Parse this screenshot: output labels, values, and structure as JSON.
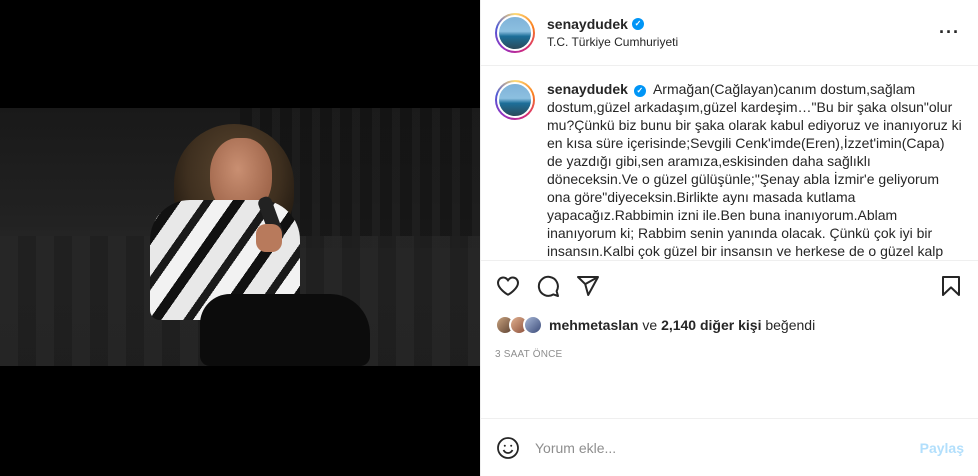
{
  "post": {
    "username": "senaydudek",
    "location": "T.C. Türkiye Cumhuriyeti",
    "more_icon": "more-horizontal-icon",
    "verified_icon": "verified-badge-icon"
  },
  "caption": {
    "username": "senaydudek",
    "text": "Armağan(Cağlayan)canım dostum,sağlam dostum,güzel arkadaşım,güzel kardeşim…\"Bu bir şaka olsun\"olur mu?Çünkü biz bunu bir şaka olarak kabul ediyoruz ve inanıyoruz ki en kısa süre içerisinde;Sevgili Cenk'imde(Eren),İzzet'imin(Capa) de yazdığı gibi,sen aramıza,eskisinden daha sağlıklı döneceksin.Ve o güzel gülüşünle;\"Şenay abla İzmir'e geliyorum ona göre\"diyeceksin.Birlikte aynı masada kutlama yapacağız.Rabbimin izni ile.Ben buna inanıyorum.Ablam inanıyorum ki; Rabbim senin yanında olacak. Çünkü çok iyi bir insansın.Kalbi çok güzel bir insansın ve herkese de o güzel kalp dokunmuştur. O akciğerdeki kitle,her neyse mutlaka bi mucize ile yok olacak.Armağan;\"Biran önce iyileş aramıza dön"
  },
  "actions": {
    "like_icon": "heart-icon",
    "comment_icon": "comment-icon",
    "share_icon": "share-icon",
    "save_icon": "bookmark-icon"
  },
  "likes": {
    "first_liker": "mehmetaslan",
    "connector": "ve",
    "others": "2,140 diğer kişi",
    "suffix": "beğendi"
  },
  "timestamp": "3 SAAT ÖNCE",
  "comment": {
    "placeholder": "Yorum ekle...",
    "post_label": "Paylaş",
    "emoji_icon": "emoji-icon"
  },
  "colors": {
    "verified": "#0095f6",
    "post_button_disabled": "#b2dffc",
    "muted_text": "#8e8e8e"
  }
}
